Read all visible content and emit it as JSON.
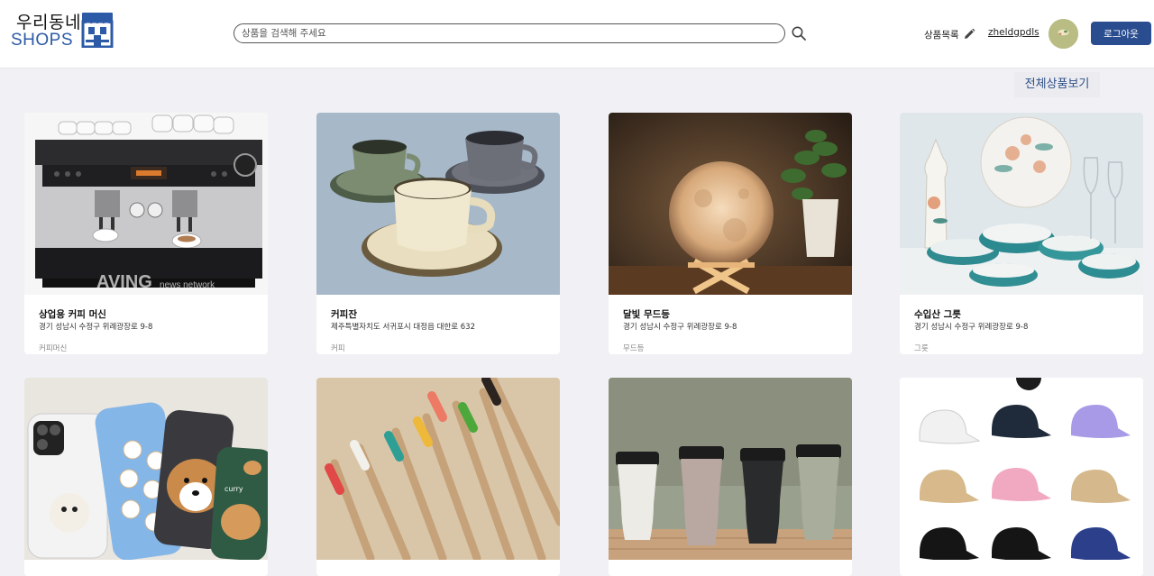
{
  "header": {
    "logo_top": "우리동네",
    "logo_bottom": "SHOPS",
    "search_placeholder": "상품을 검색해 주세요",
    "nav_products": "상품목록",
    "username": "zheldgpdls",
    "logout_label": "로그아웃"
  },
  "main": {
    "view_all_label": "전체상품보기"
  },
  "products": [
    {
      "title": "상업용 커피 머신",
      "address": "경기 성남시 수정구 위례광장로 9-8",
      "category": "커피머신",
      "watermark": "AVING",
      "watermark_sub": "news network"
    },
    {
      "title": "커피잔",
      "address": "제주특별자치도 서귀포시 대정읍 대한로 632",
      "category": "커피"
    },
    {
      "title": "달빛 무드등",
      "address": "경기 성남시 수정구 위례광장로 9-8",
      "category": "무드등"
    },
    {
      "title": "수입산 그릇",
      "address": "경기 성남시 수정구 위례광장로 9-8",
      "category": "그릇"
    },
    {
      "title": "",
      "address": "",
      "category": "",
      "phone_case_text": "curry"
    },
    {
      "title": "",
      "address": "",
      "category": ""
    },
    {
      "title": "",
      "address": "",
      "category": ""
    },
    {
      "title": "",
      "address": "",
      "category": ""
    }
  ],
  "colors": {
    "accent": "#2a4d8f",
    "background": "#f1f1f5",
    "logo_blue": "#2d5aa6"
  },
  "icons": [
    "store-icon",
    "search-icon",
    "pencil-icon",
    "avatar"
  ]
}
